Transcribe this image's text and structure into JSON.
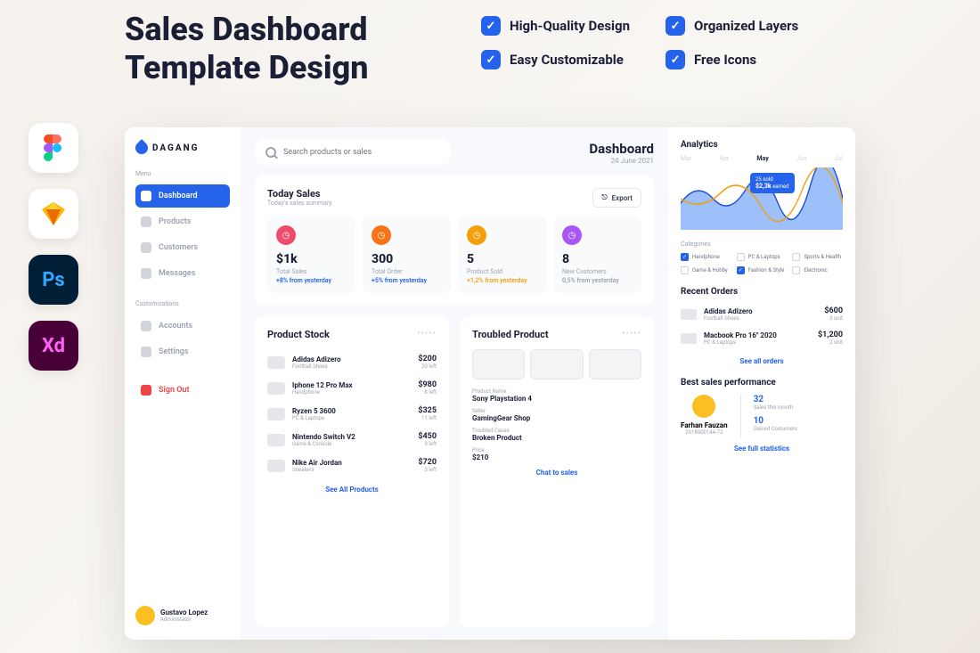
{
  "promo": {
    "title_line1": "Sales Dashboard",
    "title_line2": "Template Design",
    "features": [
      "High-Quality Design",
      "Organized Layers",
      "Easy Customizable",
      "Free Icons"
    ],
    "tools": [
      "Figma",
      "Sketch",
      "Ps",
      "Xd"
    ]
  },
  "brand": "DAGANG",
  "search": {
    "placeholder": "Search products or sales"
  },
  "header": {
    "title": "Dashboard",
    "date": "24 June 2021"
  },
  "sidebar": {
    "menu_label": "Menu",
    "items": [
      {
        "label": "Dashboard",
        "active": true
      },
      {
        "label": "Products",
        "active": false
      },
      {
        "label": "Customers",
        "active": false
      },
      {
        "label": "Messages",
        "active": false
      }
    ],
    "custom_label": "Customizations",
    "custom_items": [
      {
        "label": "Accounts"
      },
      {
        "label": "Settings"
      }
    ],
    "signout": "Sign Out",
    "user": {
      "name": "Gustavo Lopez",
      "role": "Administator"
    }
  },
  "today_sales": {
    "title": "Today Sales",
    "subtitle": "Today's sales summary",
    "export": "Export",
    "stats": [
      {
        "icon_color": "#ef4b6c",
        "value": "$1k",
        "label": "Total Sales",
        "delta": "+8% from yesterday",
        "delta_color": "#2563eb"
      },
      {
        "icon_color": "#f97316",
        "value": "300",
        "label": "Total Order",
        "delta": "+5% from yesterday",
        "delta_color": "#2563eb"
      },
      {
        "icon_color": "#f59e0b",
        "value": "5",
        "label": "Product Sold",
        "delta": "+1,2% from yesterday",
        "delta_color": "#f59e0b"
      },
      {
        "icon_color": "#a855f7",
        "value": "8",
        "label": "New Customers",
        "delta": "0,5% from yesterday",
        "delta_color": "#9ca3af"
      }
    ]
  },
  "product_stock": {
    "title": "Product Stock",
    "items": [
      {
        "name": "Adidas Adizero",
        "category": "Football Shoes",
        "price": "$200",
        "left": "20 left"
      },
      {
        "name": "Iphone 12 Pro Max",
        "category": "Handphone",
        "price": "$980",
        "left": "8 left"
      },
      {
        "name": "Ryzen 5 3600",
        "category": "PC & Laptops",
        "price": "$325",
        "left": "11 left"
      },
      {
        "name": "Nintendo Switch V2",
        "category": "Game & Console",
        "price": "$450",
        "left": "9 left"
      },
      {
        "name": "Nike Air Jordan",
        "category": "Sneakers",
        "price": "$720",
        "left": "3 left"
      }
    ],
    "see_all": "See All Products"
  },
  "troubled": {
    "title": "Troubled Product",
    "fields": {
      "product_name_label": "Product Name",
      "product_name": "Sony Playstation 4",
      "seller_label": "Seller",
      "seller": "GamingGear Shop",
      "cause_label": "Troubled Cause",
      "cause": "Broken Product",
      "price_label": "Price",
      "price": "$210"
    },
    "chat": "Chat to sales"
  },
  "analytics": {
    "title": "Analytics",
    "months": [
      "Mar",
      "Apr",
      "May",
      "Jun",
      "Jul"
    ],
    "active_month": "May",
    "tooltip": {
      "sold": "25 sold",
      "value": "$2,3k",
      "suffix": "earned"
    },
    "categories_label": "Categories",
    "categories": [
      {
        "label": "Handphone",
        "checked": true
      },
      {
        "label": "PC & Laptops",
        "checked": false
      },
      {
        "label": "Sports & Health",
        "checked": false
      },
      {
        "label": "Game & Hobby",
        "checked": false
      },
      {
        "label": "Fashion & Style",
        "checked": true
      },
      {
        "label": "Electronic",
        "checked": false
      }
    ]
  },
  "recent_orders": {
    "title": "Recent Orders",
    "items": [
      {
        "name": "Adidas Adizero",
        "category": "Football Shoes",
        "price": "$600",
        "unit": "3 unit"
      },
      {
        "name": "Macbook Pro 16\" 2020",
        "category": "PC & Laptops",
        "price": "$1,200",
        "unit": "2 unit"
      }
    ],
    "see_all": "See all orders"
  },
  "best_sales": {
    "title": "Best sales performance",
    "user": {
      "name": "Farhan Fauzan",
      "id": "2018000144-72"
    },
    "stats": [
      {
        "value": "32",
        "label": "Sales this month"
      },
      {
        "value": "10",
        "label": "Gained Costumers"
      }
    ],
    "see_full": "See full statistics"
  },
  "chart_data": {
    "type": "area",
    "series": [
      {
        "name": "Handphone",
        "color": "#3b82f6",
        "values": [
          40,
          20,
          55,
          35,
          60,
          30,
          50
        ]
      },
      {
        "name": "Fashion & Style",
        "color": "#f59e0b",
        "values": [
          30,
          45,
          25,
          50,
          28,
          48,
          35
        ]
      }
    ],
    "x": [
      0,
      1,
      2,
      3,
      4,
      5,
      6
    ],
    "ylim": [
      0,
      70
    ],
    "tooltip_point": {
      "x": 3,
      "sold": 25,
      "value": 2300
    }
  }
}
